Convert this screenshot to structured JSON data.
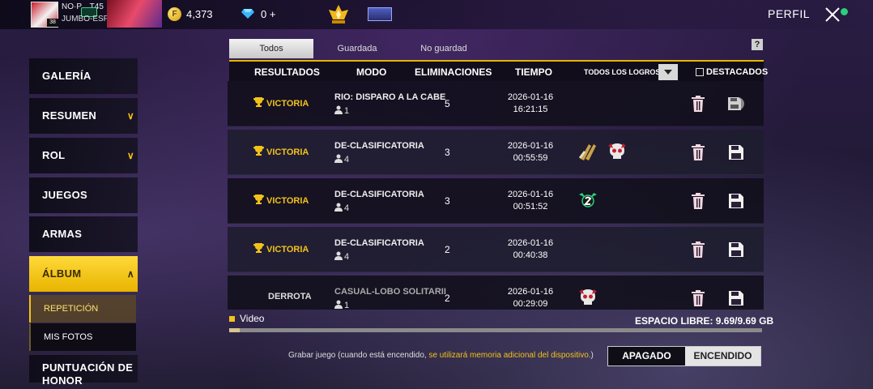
{
  "topbar": {
    "player_name": "NO·P... T45",
    "guild_name": "JUMBO-ESPORT",
    "avatar_level": "38",
    "coins": "4,373",
    "diamonds": "0 +",
    "perfil": "PERFIL",
    "coin_symbol": "F"
  },
  "sidebar": {
    "items": [
      {
        "label": "GALERÍA"
      },
      {
        "label": "RESUMEN"
      },
      {
        "label": "ROL"
      },
      {
        "label": "JUEGOS"
      },
      {
        "label": "ARMAS"
      },
      {
        "label": "ÁLBUM"
      }
    ],
    "sub_items": [
      {
        "label": "REPETICIÓN"
      },
      {
        "label": "MIS FOTOS"
      }
    ],
    "last_item": "PUNTUACIÓN DE HONOR"
  },
  "tabs": [
    "Todos",
    "Guardada",
    "No guardad"
  ],
  "help": "?",
  "table": {
    "headers": [
      "RESULTADOS",
      "MODO",
      "ELIMINACIONES",
      "TIEMPO"
    ],
    "filter_label": "TODOS LOS LOGROS",
    "destacados": "DESTACADOS",
    "rows": [
      {
        "result": "VICTORIA",
        "mode": "RIO: DISPARO A LA CABE",
        "players": "1",
        "kills": "5",
        "date": "2026-01-16",
        "time": "16:21:15"
      },
      {
        "result": "VICTORIA",
        "mode": "DE-CLASIFICATORIA",
        "players": "4",
        "kills": "3",
        "date": "2026-01-16",
        "time": "00:55:59"
      },
      {
        "result": "VICTORIA",
        "mode": "DE-CLASIFICATORIA",
        "players": "4",
        "kills": "3",
        "date": "2026-01-16",
        "time": "00:51:52"
      },
      {
        "result": "VICTORIA",
        "mode": "DE-CLASIFICATORIA",
        "players": "4",
        "kills": "2",
        "date": "2026-01-16",
        "time": "00:40:38"
      },
      {
        "result": "DERROTA",
        "mode": "CASUAL-LOBO SOLITARII",
        "players": "1",
        "kills": "2",
        "date": "2026-01-16",
        "time": "00:29:09"
      }
    ]
  },
  "storage": {
    "video_label": "Video",
    "space_label": "ESPACIO LIBRE: 9.69/9.69 GB",
    "used_fraction": 0.02
  },
  "recording": {
    "note_prefix": "Grabar juego (cuando está encendido, ",
    "note_highlight": "se utilizará memoria adicional del dispositivo.",
    "note_suffix": ")",
    "off_label": "APAGADO",
    "on_label": "ENCENDIDO"
  },
  "colors": {
    "accent": "#f2c21a",
    "active_sidebar": "#ffd93a"
  }
}
